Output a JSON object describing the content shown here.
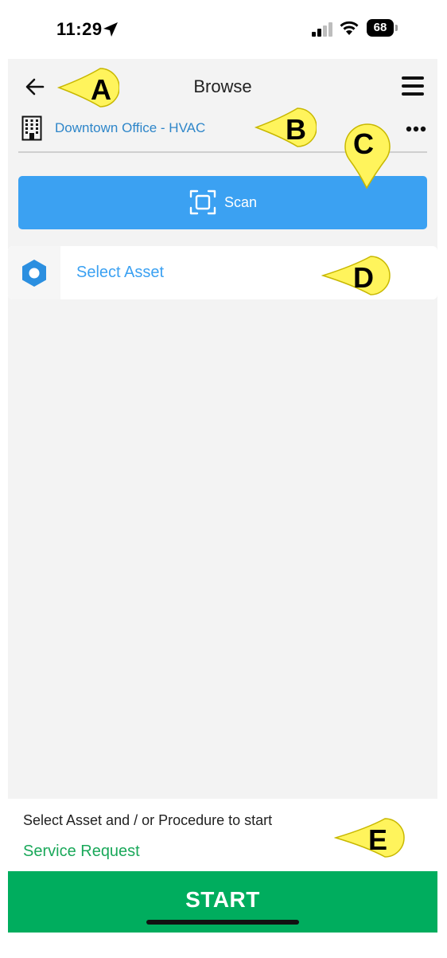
{
  "status_bar": {
    "time": "11:29",
    "battery": "68"
  },
  "header": {
    "title": "Browse"
  },
  "location": {
    "name": "Downtown Office - HVAC"
  },
  "scan": {
    "label": "Scan"
  },
  "asset": {
    "label": "Select Asset"
  },
  "footer": {
    "hint": "Select Asset and / or Procedure to start",
    "link": "Service Request",
    "start_label": "START"
  },
  "annotations": [
    "A",
    "B",
    "C",
    "D",
    "E"
  ],
  "colors": {
    "scan_button": "#3ba1f2",
    "link_blue": "#2e86c9",
    "start_green": "#00ad5e",
    "service_green": "#1aa85a",
    "callout_yellow": "#fff45c",
    "app_background": "#f3f3f3"
  },
  "icons": [
    "location-arrow-icon",
    "signal-icon",
    "wifi-icon",
    "battery-icon",
    "back-arrow-icon",
    "hamburger-menu-icon",
    "building-icon",
    "more-dots-icon",
    "scan-frame-icon",
    "hexagon-asset-icon"
  ]
}
